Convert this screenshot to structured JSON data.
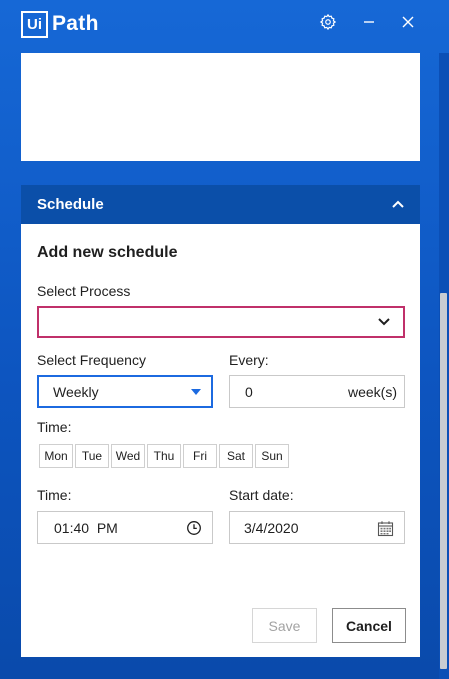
{
  "app": {
    "logo_box": "Ui",
    "logo_text": "Path"
  },
  "schedule": {
    "header_title": "Schedule",
    "heading": "Add new schedule",
    "select_process_label": "Select Process",
    "select_process_value": "",
    "frequency_label": "Select Frequency",
    "frequency_value": "Weekly",
    "every_label": "Every:",
    "every_value": "0",
    "every_unit": "week(s)",
    "days_label": "Time:",
    "days": [
      "Mon",
      "Tue",
      "Wed",
      "Thu",
      "Fri",
      "Sat",
      "Sun"
    ],
    "time_label": "Time:",
    "time_value": "01:40  PM",
    "start_date_label": "Start date:",
    "start_date_value": "3/4/2020",
    "save_label": "Save",
    "cancel_label": "Cancel"
  },
  "colors": {
    "background": "#1466d4",
    "header": "#0b4fa9",
    "focus_border": "#1c6ae0",
    "error_border": "#c0306a"
  }
}
